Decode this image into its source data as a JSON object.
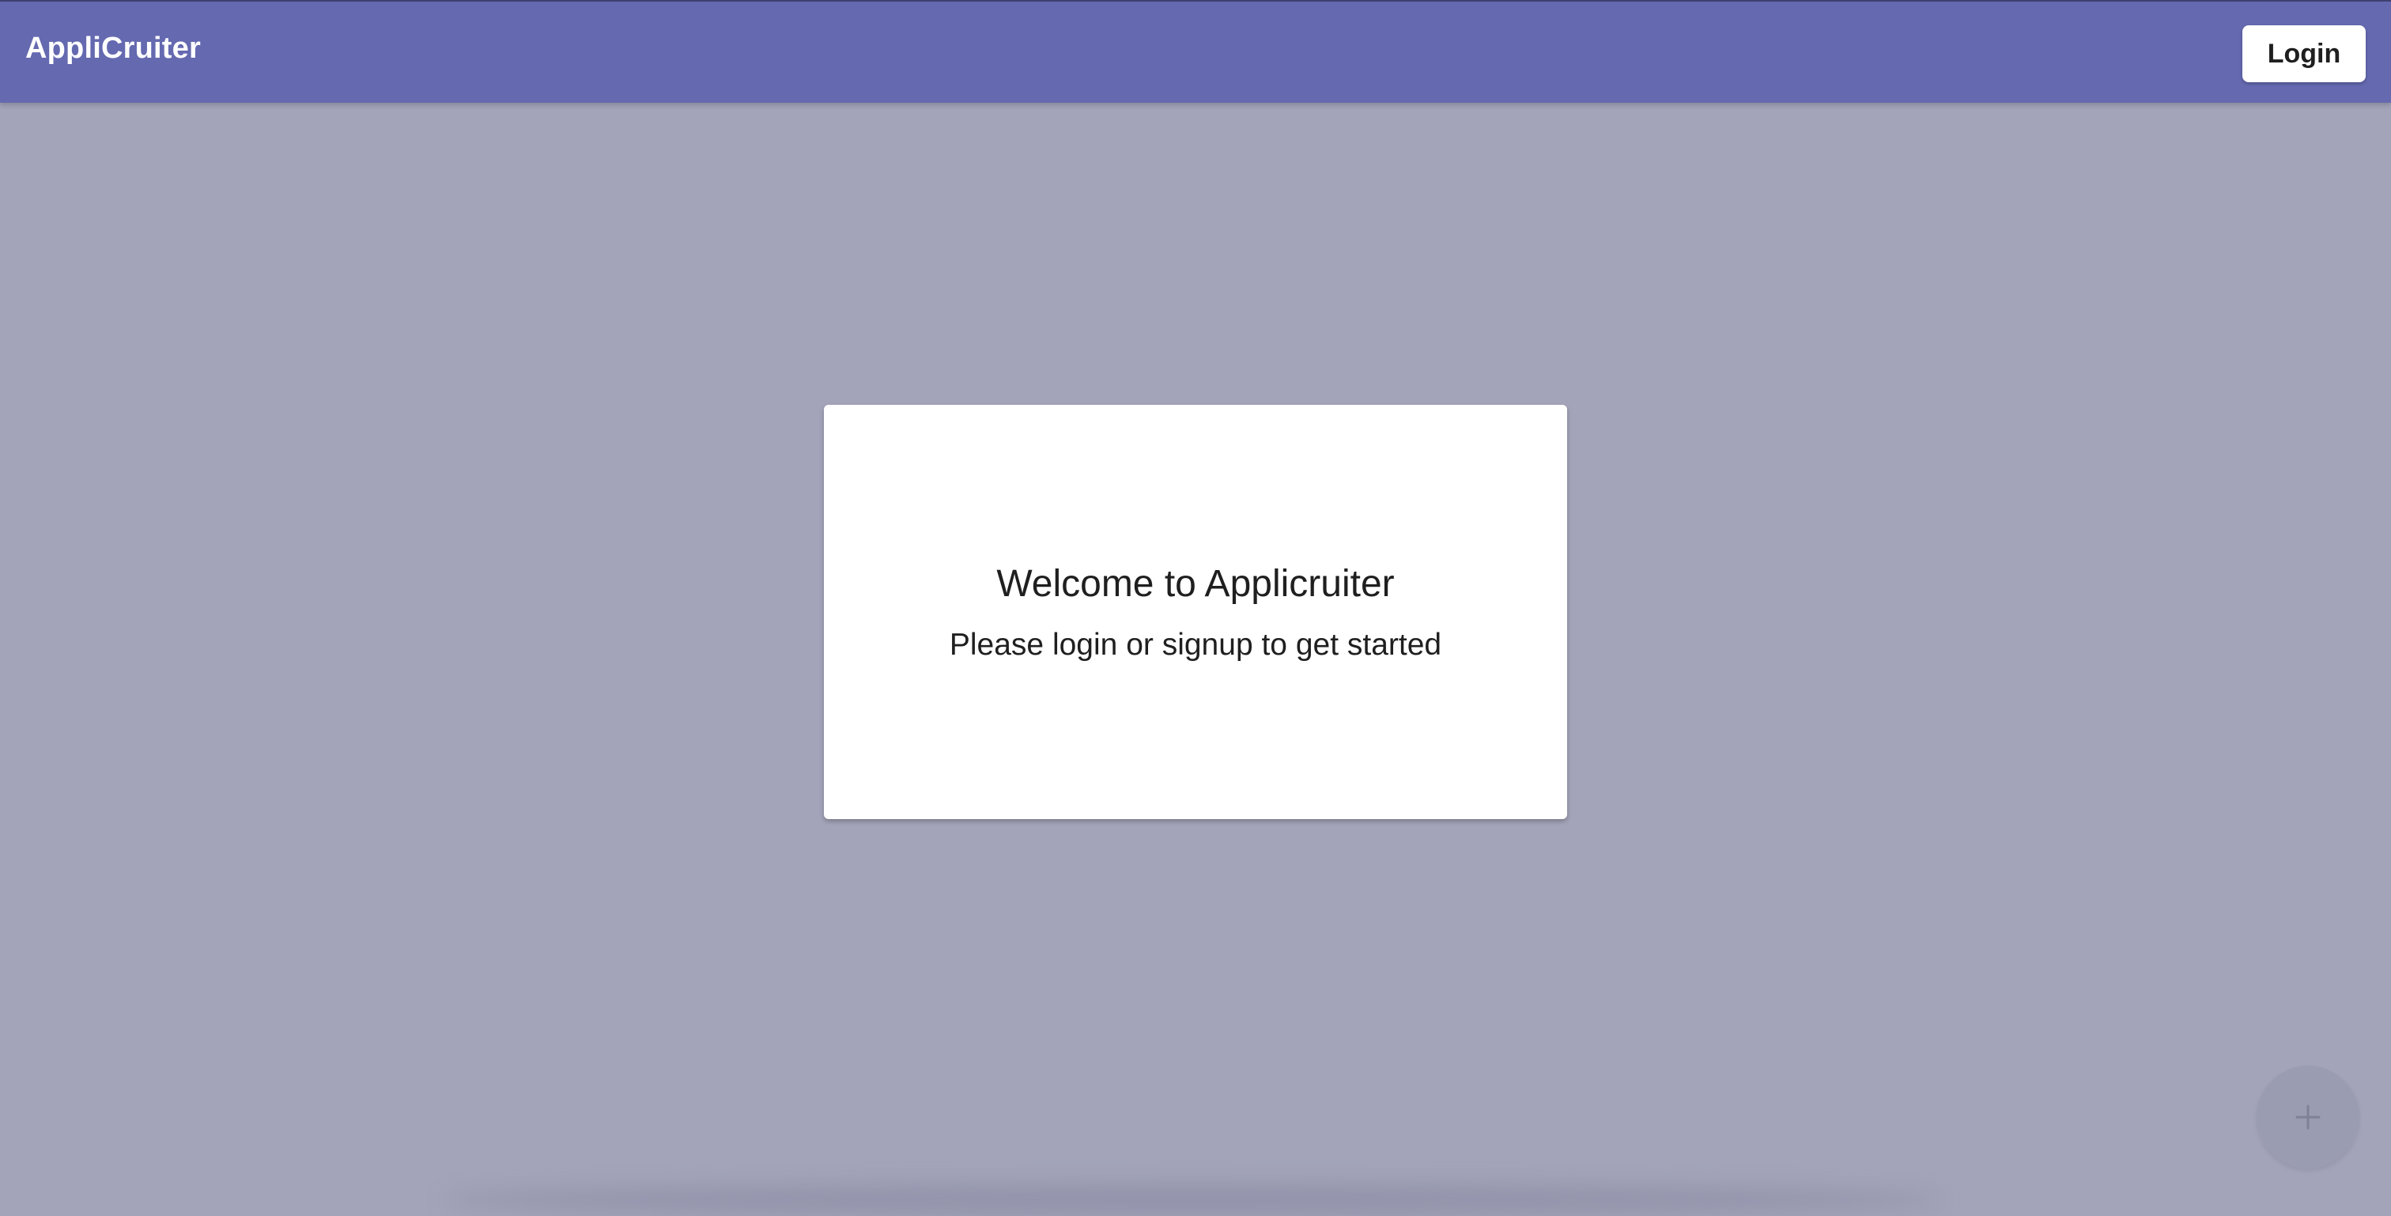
{
  "app": {
    "title": "AppliCruiter",
    "login_label": "Login"
  },
  "welcome": {
    "heading": "Welcome to Applicruiter",
    "message": "Please login or signup to get started"
  },
  "fab": {
    "icon": "plus-icon"
  },
  "colors": {
    "app_bar": "#6569b0",
    "page_background": "#a3a4b9",
    "card_background": "#ffffff",
    "fab_background": "#9a9cb2"
  }
}
